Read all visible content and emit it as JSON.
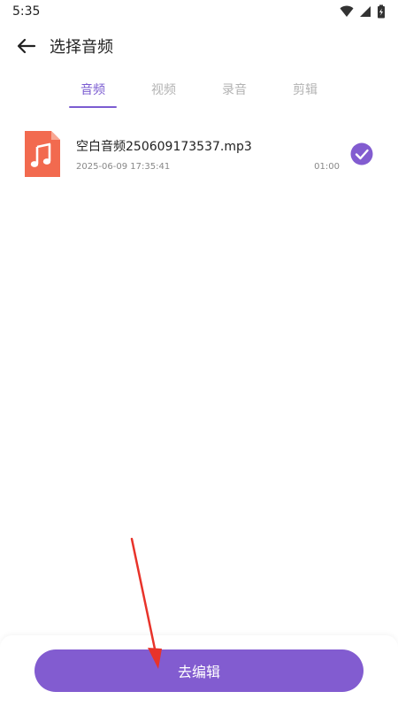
{
  "status_bar": {
    "time": "5:35"
  },
  "app_bar": {
    "title": "选择音频"
  },
  "tabs": [
    {
      "label": "音频",
      "active": true
    },
    {
      "label": "视频",
      "active": false
    },
    {
      "label": "录音",
      "active": false
    },
    {
      "label": "剪辑",
      "active": false
    }
  ],
  "files": [
    {
      "name": "空白音频250609173537.mp3",
      "date": "2025-06-09 17:35:41",
      "duration": "01:00",
      "selected": true
    }
  ],
  "bottom": {
    "button_label": "去编辑"
  },
  "colors": {
    "accent": "#7b5cd1",
    "button": "#825cd0",
    "file_icon": "#f26a4f",
    "annotation_arrow": "#e8332a"
  },
  "icons": {
    "back": "arrow-left-icon",
    "file": "music-file-icon",
    "check": "check-circle-icon",
    "wifi": "wifi-icon",
    "signal": "signal-icon",
    "battery": "battery-icon"
  }
}
